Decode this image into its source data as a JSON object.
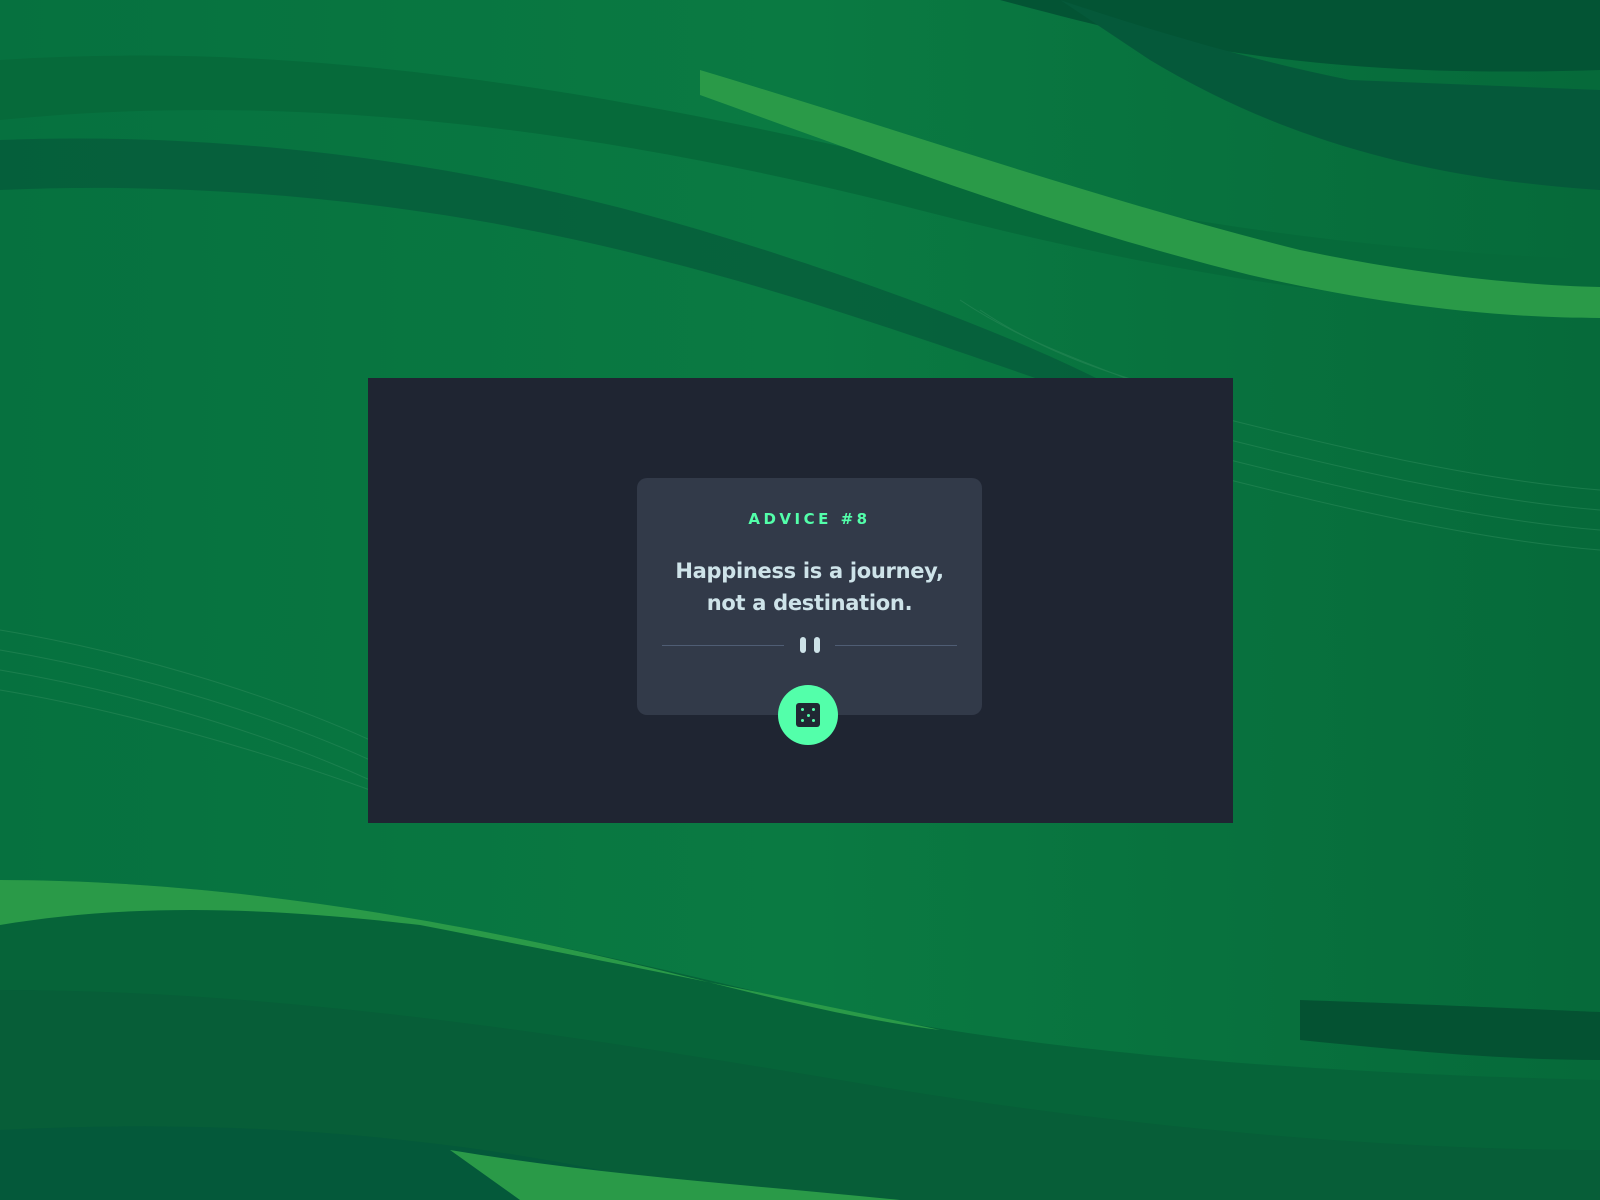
{
  "advice": {
    "label": "ADVICE #8",
    "text": "Happiness is a journey, not a destination."
  },
  "icons": {
    "divider": "pause-icon",
    "button": "dice-icon"
  },
  "colors": {
    "background_green": "#046c3c",
    "frame": "#1f2532",
    "card": "#323a49",
    "accent": "#53ffaa",
    "text": "#cee3e9"
  }
}
